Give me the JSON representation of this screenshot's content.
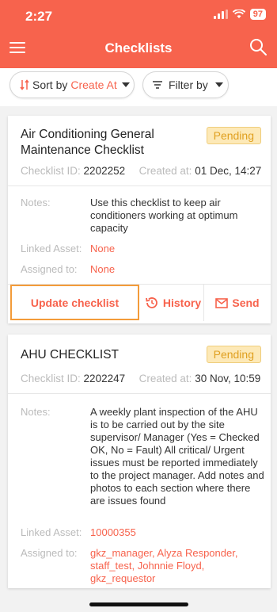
{
  "status": {
    "time": "2:27",
    "battery": "97"
  },
  "header": {
    "title": "Checklists"
  },
  "filters": {
    "sort_prefix": "Sort by",
    "sort_value": "Create At",
    "filter_label": "Filter by"
  },
  "checklists": [
    {
      "title": "Air Conditioning General Maintenance Checklist",
      "status": "Pending",
      "id_label": "Checklist ID:",
      "id": "2202252",
      "created_label": "Created at:",
      "created": "01 Dec, 14:27",
      "notes_label": "Notes:",
      "notes": "Use this checklist to keep air conditioners working at optimum capacity",
      "linked_label": "Linked Asset:",
      "linked": "None",
      "assigned_label": "Assigned to:",
      "assigned": "None",
      "actions": {
        "update": "Update checklist",
        "history": "History",
        "send": "Send"
      }
    },
    {
      "title": "AHU CHECKLIST",
      "status": "Pending",
      "id_label": "Checklist ID:",
      "id": "2202247",
      "created_label": "Created at:",
      "created": "30 Nov, 10:59",
      "notes_label": "Notes:",
      "notes": "A weekly plant inspection of the AHU is to be carried out by the site supervisor/ Manager (Yes = Checked OK, No = Fault) All critical/ Urgent issues must be reported immediately to the project manager. Add notes and photos to each section where there are issues found",
      "linked_label": "Linked Asset:",
      "linked": "10000355",
      "assigned_label": "Assigned to:",
      "assigned": "gkz_manager, Alyza Responder, staff_test, Johnnie Floyd, gkz_requestor"
    }
  ],
  "colors": {
    "accent": "#f7634d",
    "pending_bg": "#fde9b7",
    "pending_text": "#e0a020"
  }
}
